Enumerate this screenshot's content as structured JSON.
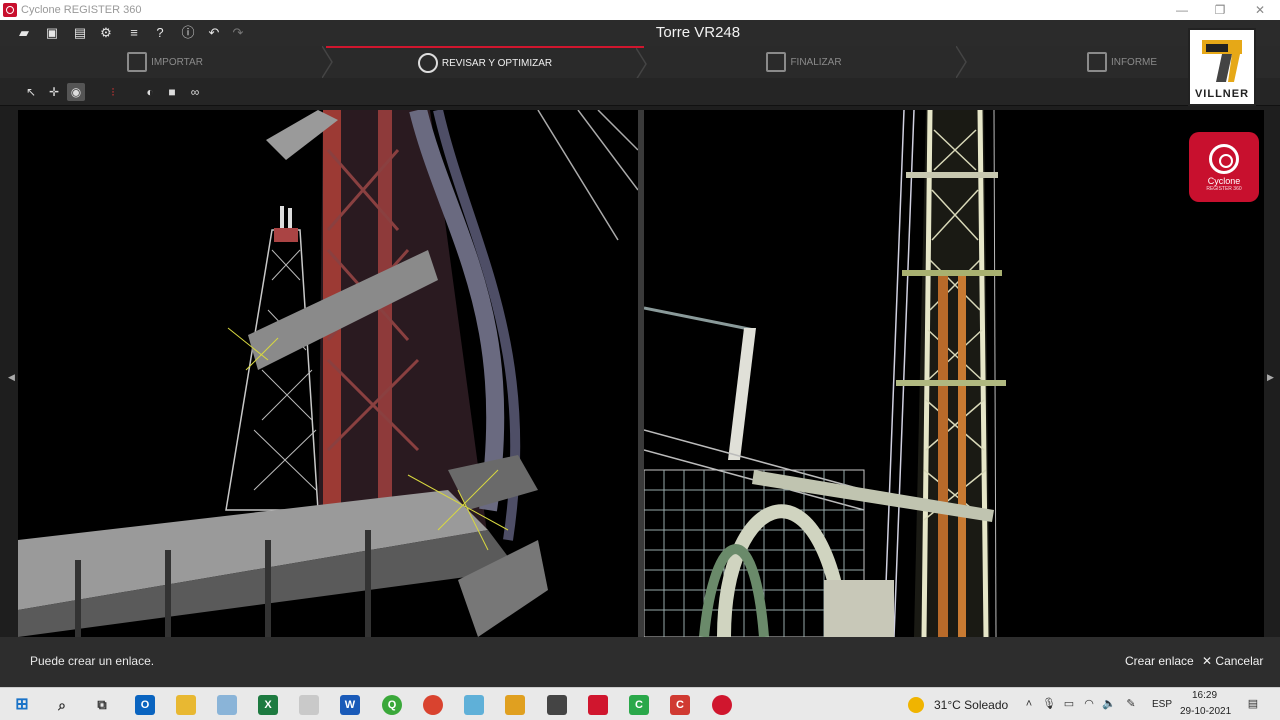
{
  "window": {
    "title": "Cyclone REGISTER 360"
  },
  "header": {
    "project_title": "Torre VR248"
  },
  "steps": [
    {
      "label": "IMPORTAR"
    },
    {
      "label": "REVISAR Y OPTIMIZAR"
    },
    {
      "label": "FINALIZAR"
    },
    {
      "label": "INFORME"
    }
  ],
  "logo": {
    "text": "VILLNER"
  },
  "badge": {
    "name": "Cyclone",
    "sub": "REGISTER 360"
  },
  "status": {
    "message": "Puede crear un enlace.",
    "create_link": "Crear enlace",
    "cancel": "Cancelar",
    "cancel_glyph": "✕"
  },
  "taskbar": {
    "weather": "31°C  Soleado",
    "lang": "ESP",
    "time": "16:29",
    "date": "29-10-2021"
  },
  "colors": {
    "accent": "#d0162e",
    "brand": "#c8102e"
  }
}
